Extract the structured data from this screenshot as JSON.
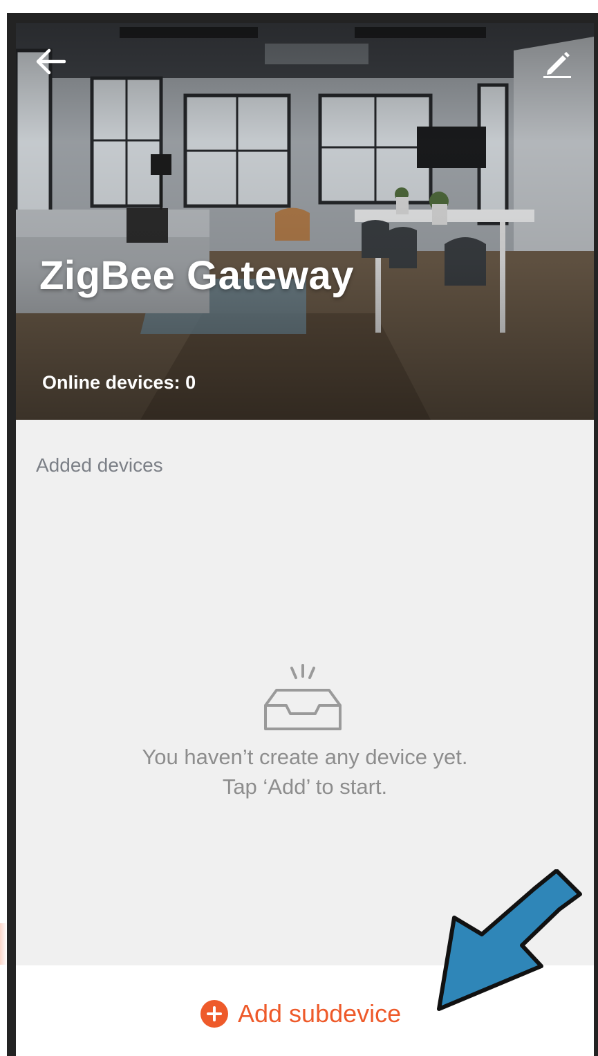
{
  "header": {
    "title": "ZigBee Gateway",
    "online_label": "Online devices: 0",
    "back_icon": "back-arrow-icon",
    "edit_icon": "pencil-icon"
  },
  "section": {
    "label": "Added devices"
  },
  "empty_state": {
    "icon": "empty-inbox-icon",
    "line1": "You haven’t create any device yet.",
    "line2": "Tap ‘Add’ to start."
  },
  "bottom": {
    "add_label": "Add subdevice",
    "plus_icon": "plus-circle-icon"
  },
  "colors": {
    "accent": "#ee5a2a",
    "background": "#f0f0f0",
    "muted_text": "#8d8d8d",
    "annotation_arrow": "#2f86b8"
  }
}
